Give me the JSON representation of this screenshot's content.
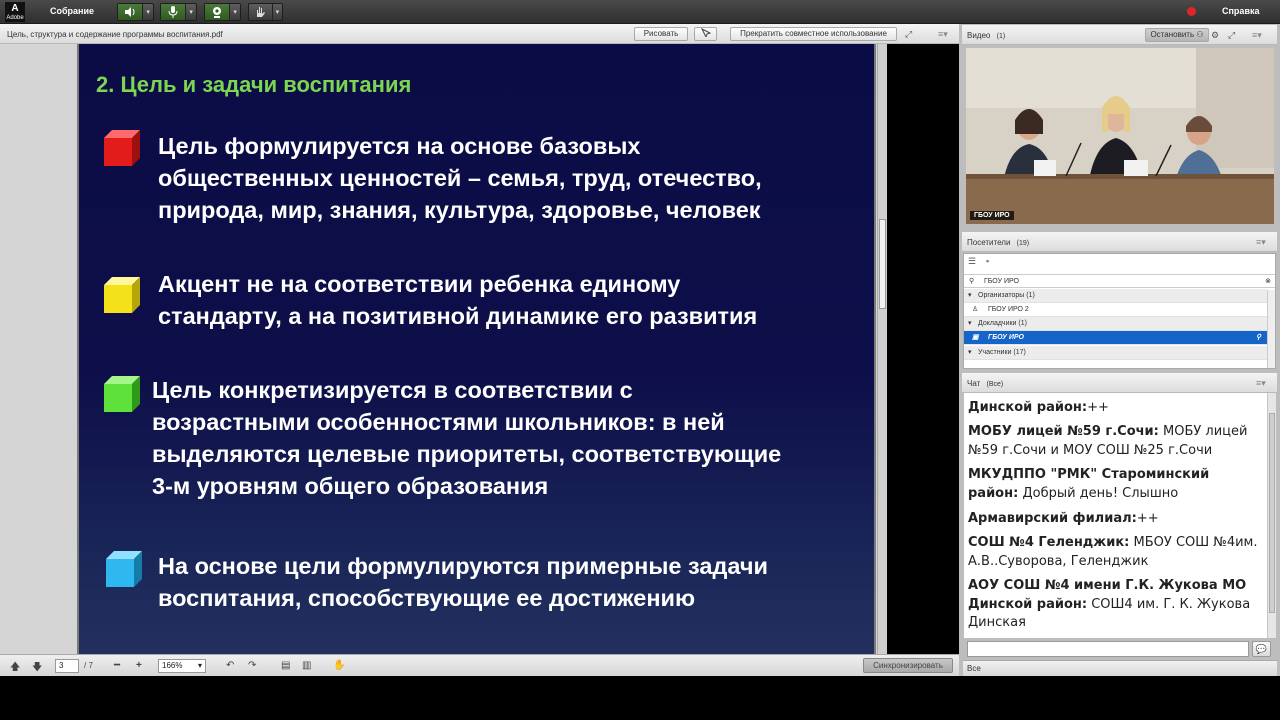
{
  "app": {
    "logo_text": "Adobe",
    "logo_mark": "A",
    "menu_meeting": "Собрание",
    "menu_help": "Справка"
  },
  "share": {
    "title": "Цель, структура и содержание программы воспитания.pdf",
    "draw_label": "Рисовать",
    "stop_label": "Прекратить совместное использование",
    "page_current": "3",
    "page_total": "/ 7",
    "zoom": "166%",
    "sync_label": "Синхронизировать"
  },
  "slide": {
    "title": "2.  Цель и задачи воспитания",
    "bullets": [
      {
        "color": "#e21b1b",
        "lines": [
          "Цель формулируется на основе базовых",
          "общественных ценностей – семья, труд, отечество,",
          "природа, мир, знания, культура, здоровье, человек"
        ]
      },
      {
        "color": "#f3e21a",
        "lines": [
          "Акцент не на соответствии ребенка единому",
          "стандарту, а на позитивной динамике его развития"
        ]
      },
      {
        "color": "#5ee13a",
        "lines": [
          "Цель конкретизируется в соответствии с",
          "возрастными особенностями школьников: в ней",
          "выделяются целевые приоритеты, соответствующие",
          "3-м уровням общего образования"
        ]
      },
      {
        "color": "#2fb8f0",
        "lines": [
          "На основе цели формулируются примерные задачи",
          "воспитания, способствующие ее достижению"
        ]
      }
    ]
  },
  "video": {
    "title": "Видео",
    "count": "(1)",
    "stop_label": "Остановить",
    "tag": "ГБОУ ИРО"
  },
  "attendees": {
    "title": "Посетители",
    "count": "(19)",
    "search_value": "ГБОУ ИРО",
    "rows": [
      {
        "label": "Организаторы (1)",
        "type": "grp"
      },
      {
        "label": "ГБОУ ИРО 2",
        "type": "item"
      },
      {
        "label": "Докладчики (1)",
        "type": "grp"
      },
      {
        "label": "ГБОУ ИРО",
        "type": "sel"
      },
      {
        "label": "Участники (17)",
        "type": "grp"
      }
    ]
  },
  "chat": {
    "title": "Чат",
    "scope": "(Все)",
    "footer": "Все",
    "messages": [
      {
        "sender": "Динской район:",
        "text": "++"
      },
      {
        "sender": "МОБУ лицей №59 г.Сочи:",
        "text": "МОБУ лицей №59 г.Сочи и МОУ СОШ №25 г.Сочи"
      },
      {
        "sender": "МКУДППО \"РМК\" Староминский район:",
        "text": "Добрый день! Слышно"
      },
      {
        "sender": "Армавирский филиал:",
        "text": "++"
      },
      {
        "sender": "СОШ №4 Геленджик:",
        "text": "МБОУ СОШ №4им. А.В..Суворова, Геленджик"
      },
      {
        "sender": "АОУ СОШ №4 имени Г.К. Жукова МО Динской район:",
        "text": "СОШ4 им. Г. К. Жукова Динская"
      }
    ]
  }
}
